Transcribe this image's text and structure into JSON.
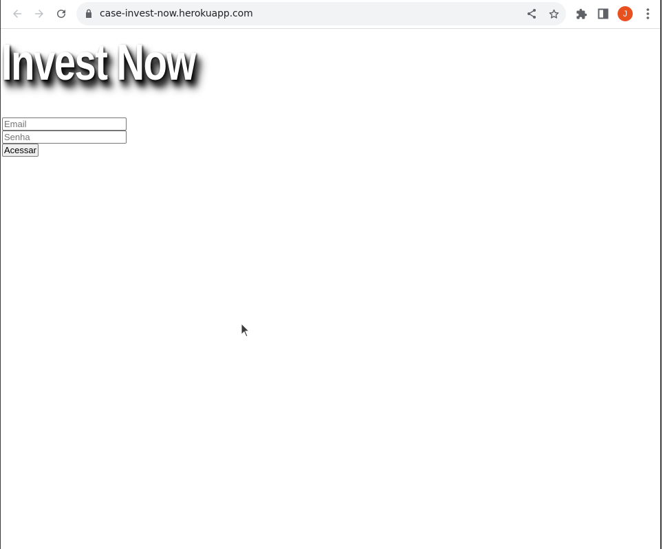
{
  "browser": {
    "url": "case-invest-now.herokuapp.com",
    "profile_initial": "J",
    "profile_color": "#e8501f"
  },
  "page": {
    "headline": "Invest Now",
    "email_placeholder": "Email",
    "password_placeholder": "Senha",
    "submit_label": "Acessar"
  }
}
